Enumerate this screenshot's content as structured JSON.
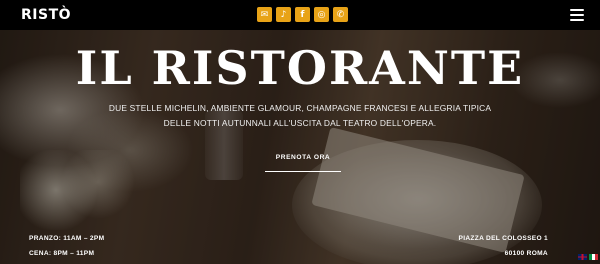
{
  "brand": {
    "logo": "RISTÒ"
  },
  "social": [
    {
      "name": "email",
      "glyph": "✉"
    },
    {
      "name": "tiktok",
      "glyph": "♪"
    },
    {
      "name": "facebook",
      "glyph": "f"
    },
    {
      "name": "instagram",
      "glyph": "◎"
    },
    {
      "name": "whatsapp",
      "glyph": "✆"
    }
  ],
  "hero": {
    "title": "IL RISTORANTE",
    "subtitle_line1": "DUE STELLE MICHELIN, AMBIENTE GLAMOUR, CHAMPAGNE FRANCESI E ALLEGRIA TIPICA",
    "subtitle_line2": "DELLE NOTTI AUTUNNALI ALL'USCITA DAL TEATRO DELL'OPERA.",
    "cta_label": "PRENOTA ORA"
  },
  "info": {
    "lunch": "PRANZO: 11AM – 2PM",
    "dinner": "CENA: 8PM – 11PM",
    "street": "PIAZZA DEL COLOSSEO 1",
    "city": "60100 ROMA"
  },
  "colors": {
    "accent": "#e8a317",
    "topbar": "#000000"
  },
  "languages": [
    "en",
    "it"
  ]
}
